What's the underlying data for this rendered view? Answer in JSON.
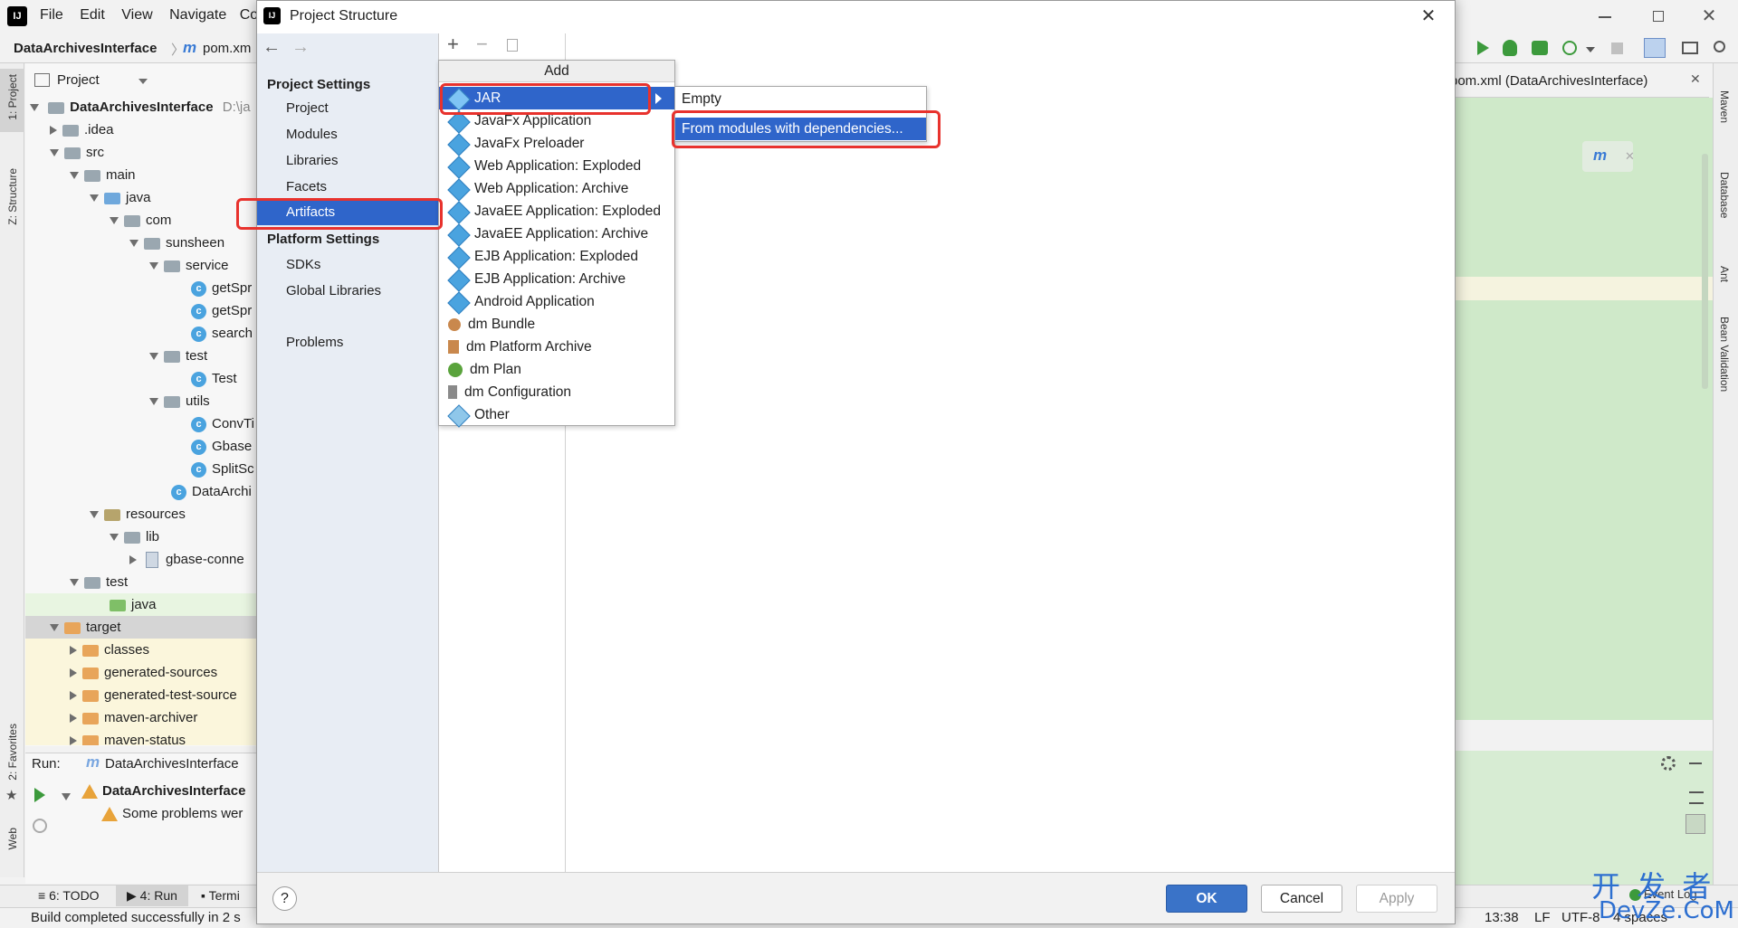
{
  "menubar": {
    "items": [
      "File",
      "Edit",
      "View",
      "Navigate",
      "Co"
    ]
  },
  "breadcrumb": {
    "project": "DataArchivesInterface",
    "file": "pom.xm"
  },
  "project_panel": {
    "title": "Project",
    "root": "DataArchivesInterface",
    "root_path": "D:\\ja",
    "tree": [
      ".idea",
      "src",
      "main",
      "java",
      "com",
      "sunsheen",
      "service",
      "getSpr",
      "getSpr",
      "search",
      "test",
      "Test",
      "utils",
      "ConvTi",
      "Gbase",
      "SplitSc",
      "DataArchi",
      "resources",
      "lib",
      "gbase-conne",
      "test",
      "java",
      "target",
      "classes",
      "generated-sources",
      "generated-test-source",
      "maven-archiver",
      "maven-status"
    ]
  },
  "left_strip": {
    "project_tab": "1: Project",
    "structure_tab": "Z: Structure",
    "favorites_tab": "2: Favorites",
    "web_tab": "Web"
  },
  "right_strip": {
    "maven": "Maven",
    "database": "Database",
    "ant": "Ant",
    "bean": "Bean Validation"
  },
  "editor": {
    "tab_title": "pom.xml (DataArchivesInterface)"
  },
  "run_panel": {
    "label": "Run:",
    "tab": "DataArchivesInterface",
    "node": "DataArchivesInterface",
    "warning": "Some problems wer"
  },
  "bottom_tabs": {
    "todo": "6: TODO",
    "run": "4: Run",
    "terminal": "Termi"
  },
  "statusbar": {
    "message": "Build completed successfully in 2 s",
    "time": "13:38",
    "line_sep": "LF",
    "encoding": "UTF-8",
    "indent": "4 spaces",
    "event_log": "Event Log"
  },
  "dialog": {
    "title": "Project Structure",
    "project_settings": "Project Settings",
    "project_items": [
      "Project",
      "Modules",
      "Libraries",
      "Facets",
      "Artifacts"
    ],
    "platform_settings": "Platform Settings",
    "platform_items": [
      "SDKs",
      "Global Libraries"
    ],
    "problems": "Problems",
    "add_menu_title": "Add",
    "add_items": [
      "JAR",
      "JavaFx Application",
      "JavaFx Preloader",
      "Web Application: Exploded",
      "Web Application: Archive",
      "JavaEE Application: Exploded",
      "JavaEE Application: Archive",
      "EJB Application: Exploded",
      "EJB Application: Archive",
      "Android Application",
      "dm Bundle",
      "dm Platform Archive",
      "dm Plan",
      "dm Configuration",
      "Other"
    ],
    "jar_submenu": [
      "Empty",
      "From modules with dependencies..."
    ],
    "ok": "OK",
    "cancel": "Cancel",
    "apply": "Apply",
    "help": "?"
  },
  "watermark": {
    "cn": "开 发 者",
    "en": "DevZe.CoM"
  },
  "colors": {
    "selection": "#2f65ca",
    "highlight_box": "#e8322d",
    "editor_green": "#cfe9c9",
    "ok_button": "#3a73c8"
  }
}
